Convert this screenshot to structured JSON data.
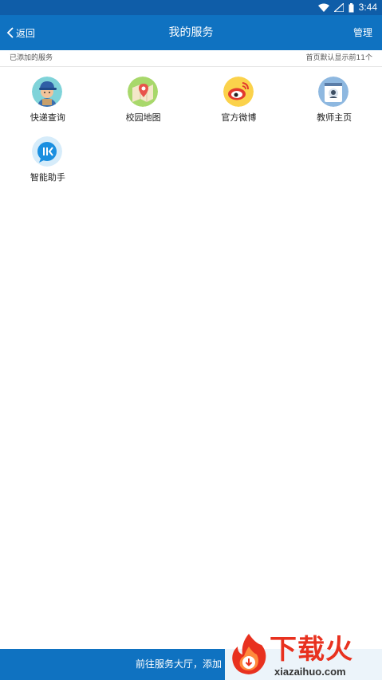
{
  "status_bar": {
    "time": "3:44"
  },
  "nav": {
    "back_label": "返回",
    "title": "我的服务",
    "manage_label": "管理"
  },
  "section": {
    "left_label": "已添加的服务",
    "right_label": "首页默认显示前11个"
  },
  "services": [
    {
      "label": "快递查询",
      "icon": "courier-icon"
    },
    {
      "label": "校园地图",
      "icon": "map-icon"
    },
    {
      "label": "官方微博",
      "icon": "weibo-icon"
    },
    {
      "label": "教师主页",
      "icon": "teacher-profile-icon"
    },
    {
      "label": "智能助手",
      "icon": "assistant-icon"
    }
  ],
  "bottom_bar": {
    "text": "前往服务大厅，添加"
  },
  "watermark": {
    "cn": "下载火",
    "en": "xiazaihuo.com"
  },
  "colors": {
    "status_bar": "#0F5DA8",
    "nav_bar": "#0F72C1",
    "watermark_red": "#e8311f"
  }
}
